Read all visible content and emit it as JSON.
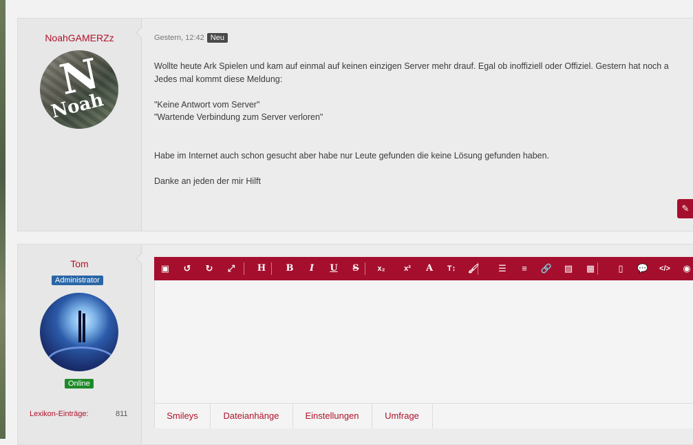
{
  "post1": {
    "username": "NoahGAMERZz",
    "avatar_text": "Noah",
    "avatar_letter": "N",
    "time": "Gestern, 12:42",
    "new_badge": "Neu",
    "paragraphs": [
      "Wollte heute Ark Spielen und kam auf einmal auf keinen einzigen Server mehr drauf. Egal ob inoffiziell oder Offiziel. Gestern hat noch a",
      "Jedes mal kommt diese Meldung:",
      "",
      "\"Keine Antwort vom Server\"",
      "\"Wartende Verbindung zum Server verloren\"",
      "",
      "",
      "Habe im Internet auch schon gesucht aber habe nur Leute gefunden die keine Lösung gefunden haben.",
      "",
      "Danke an jeden der mir Hilft"
    ],
    "edit_icon": "pencil-icon"
  },
  "post2": {
    "username": "Tom",
    "role": "Administrator",
    "status": "Online",
    "stat_label": "Lexikon-Einträge:",
    "stat_value": "811"
  },
  "toolbar": {
    "buttons": [
      {
        "name": "source-icon",
        "glyph": "▣"
      },
      {
        "name": "undo-icon",
        "glyph": "↺"
      },
      {
        "name": "redo-icon",
        "glyph": "↻"
      },
      {
        "name": "fullscreen-icon",
        "glyph": "⤢"
      },
      {
        "name": "heading-icon",
        "glyph": "H"
      },
      {
        "name": "bold-icon",
        "glyph": "B"
      },
      {
        "name": "italic-icon",
        "glyph": "I"
      },
      {
        "name": "underline-icon",
        "glyph": "U"
      },
      {
        "name": "strikethrough-icon",
        "glyph": "S"
      },
      {
        "name": "subscript-icon",
        "glyph": "x₂"
      },
      {
        "name": "superscript-icon",
        "glyph": "x²"
      },
      {
        "name": "font-color-icon",
        "glyph": "A"
      },
      {
        "name": "font-size-icon",
        "glyph": "T↕"
      },
      {
        "name": "brush-icon",
        "glyph": "🖌"
      },
      {
        "name": "list-icon",
        "glyph": "☰"
      },
      {
        "name": "align-icon",
        "glyph": "≡"
      },
      {
        "name": "link-icon",
        "glyph": "🔗"
      },
      {
        "name": "image-icon",
        "glyph": "▨"
      },
      {
        "name": "table-icon",
        "glyph": "▦"
      },
      {
        "name": "page-icon",
        "glyph": "▯"
      },
      {
        "name": "quote-icon",
        "glyph": "💬"
      },
      {
        "name": "code-icon",
        "glyph": "</>"
      },
      {
        "name": "spoiler-icon",
        "glyph": "◉"
      }
    ]
  },
  "tabs": [
    "Smileys",
    "Dateianhänge",
    "Einstellungen",
    "Umfrage"
  ],
  "colors": {
    "accent": "#a50f2d",
    "username": "#b0112a",
    "admin_badge": "#2a66a6",
    "online_badge": "#1e8a2a"
  }
}
